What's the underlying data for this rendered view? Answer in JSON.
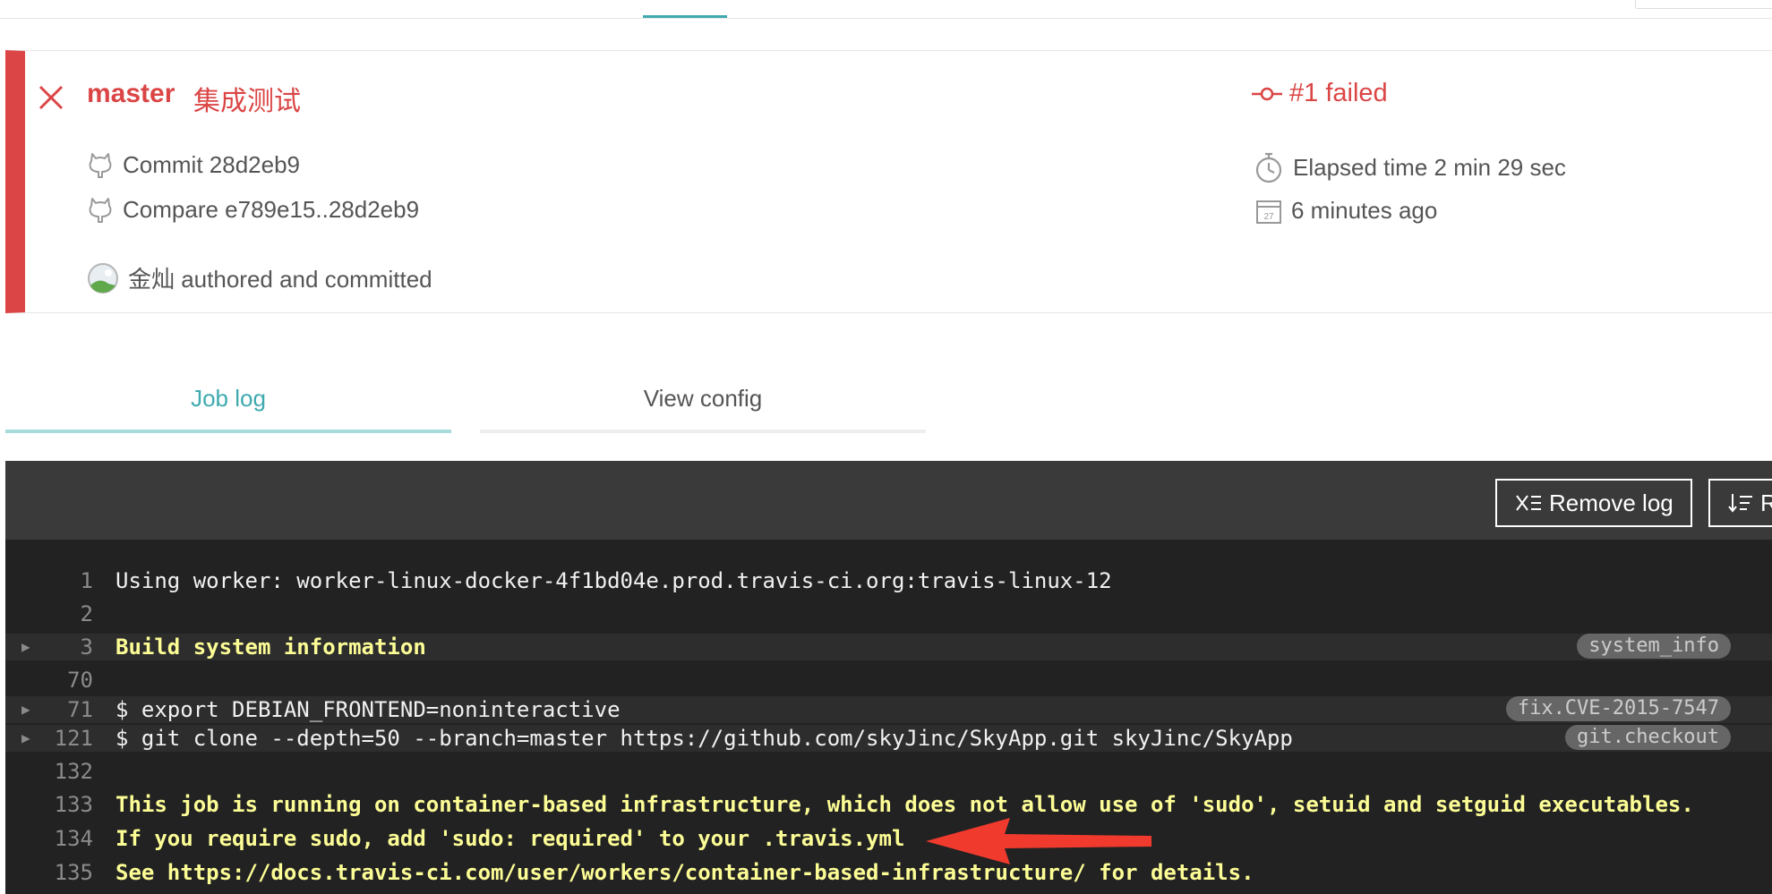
{
  "build": {
    "branch": "master",
    "commit_message": "集成测试",
    "commit_label": "Commit 28d2eb9",
    "compare_label": "Compare e789e15..28d2eb9",
    "author_label": "金灿 authored and committed",
    "status": "#1 failed",
    "elapsed": "Elapsed time 2 min 29 sec",
    "ago": "6 minutes ago",
    "calendar_day": "27",
    "status_color": "#db4545"
  },
  "tabs": {
    "job_log": "Job log",
    "view_config": "View config",
    "active_color": "#3eaaaf"
  },
  "toolbar": {
    "remove_log": "Remove log",
    "raw_log": "R"
  },
  "log": {
    "lines": [
      {
        "num": "1",
        "text": "Using worker: worker-linux-docker-4f1bd04e.prod.travis-ci.org:travis-linux-12"
      },
      {
        "num": "2",
        "text": ""
      },
      {
        "num": "3",
        "text": "Build system information",
        "tag": "system_info"
      },
      {
        "num": "70",
        "text": ""
      },
      {
        "num": "71",
        "text": "$ export DEBIAN_FRONTEND=noninteractive",
        "tag": "fix.CVE-2015-7547"
      },
      {
        "num": "121",
        "text": "$ git clone --depth=50 --branch=master https://github.com/skyJinc/SkyApp.git skyJinc/SkyApp",
        "tag": "git.checkout"
      },
      {
        "num": "132",
        "text": ""
      },
      {
        "num": "133",
        "text": "This job is running on container-based infrastructure, which does not allow use of 'sudo', setuid and setguid executables."
      },
      {
        "num": "134",
        "text": "If you require sudo, add 'sudo: required' to your .travis.yml"
      },
      {
        "num": "135",
        "text": "See https://docs.travis-ci.com/user/workers/container-based-infrastructure/ for details."
      }
    ]
  },
  "colors": {
    "log_background": "#222222",
    "log_yellow": "#fdfd96",
    "annotation_arrow": "#f03a2e"
  }
}
